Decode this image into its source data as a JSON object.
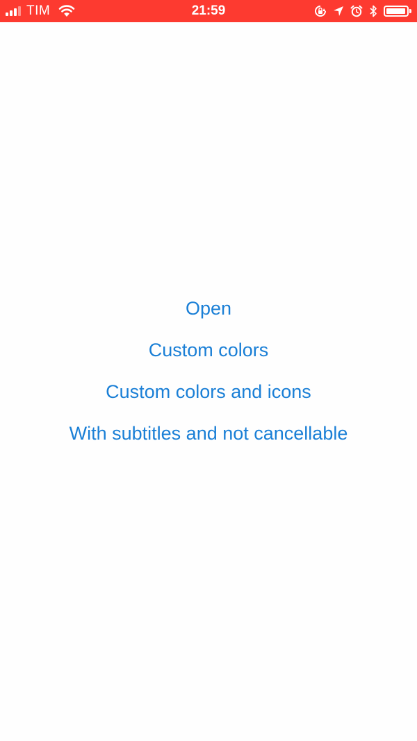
{
  "status_bar": {
    "carrier": "TIM",
    "time": "21:59",
    "background_color": "#fd3a30",
    "signal_bars_filled": 3,
    "signal_bars_total": 4,
    "battery_level": 0.95,
    "icons": [
      "signal-icon",
      "wifi-icon",
      "orientation-lock-icon",
      "location-arrow-icon",
      "alarm-icon",
      "bluetooth-icon",
      "battery-icon"
    ]
  },
  "menu": {
    "link_color": "#1a7fd6",
    "items": [
      {
        "label": "Open"
      },
      {
        "label": "Custom colors"
      },
      {
        "label": "Custom colors and icons"
      },
      {
        "label": "With subtitles and not cancellable"
      }
    ]
  }
}
